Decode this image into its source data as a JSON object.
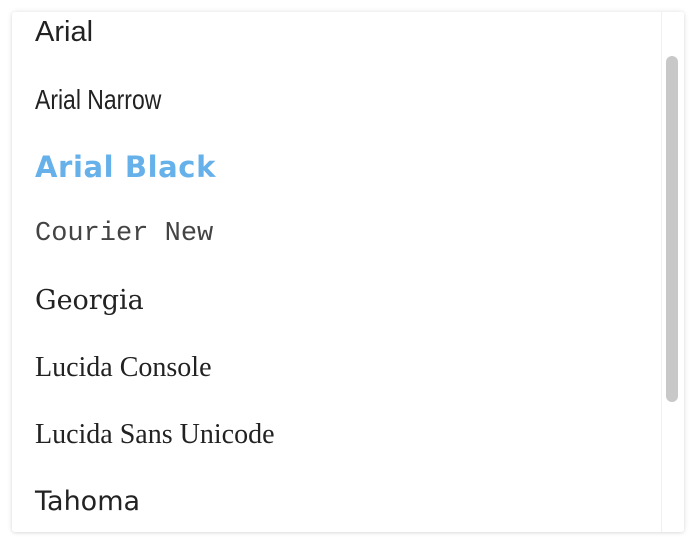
{
  "font_dropdown": {
    "items": [
      {
        "label": "Arial"
      },
      {
        "label": "Arial Narrow"
      },
      {
        "label": "Arial Black",
        "selected": true,
        "color": "#66b1ea"
      },
      {
        "label": "Courier New"
      },
      {
        "label": "Georgia"
      },
      {
        "label": "Lucida Console"
      },
      {
        "label": "Lucida Sans Unicode"
      },
      {
        "label": "Tahoma"
      }
    ]
  },
  "colors": {
    "text": "#222222",
    "highlight": "#66b1ea",
    "scrollbar_thumb": "#c8c8c8"
  }
}
